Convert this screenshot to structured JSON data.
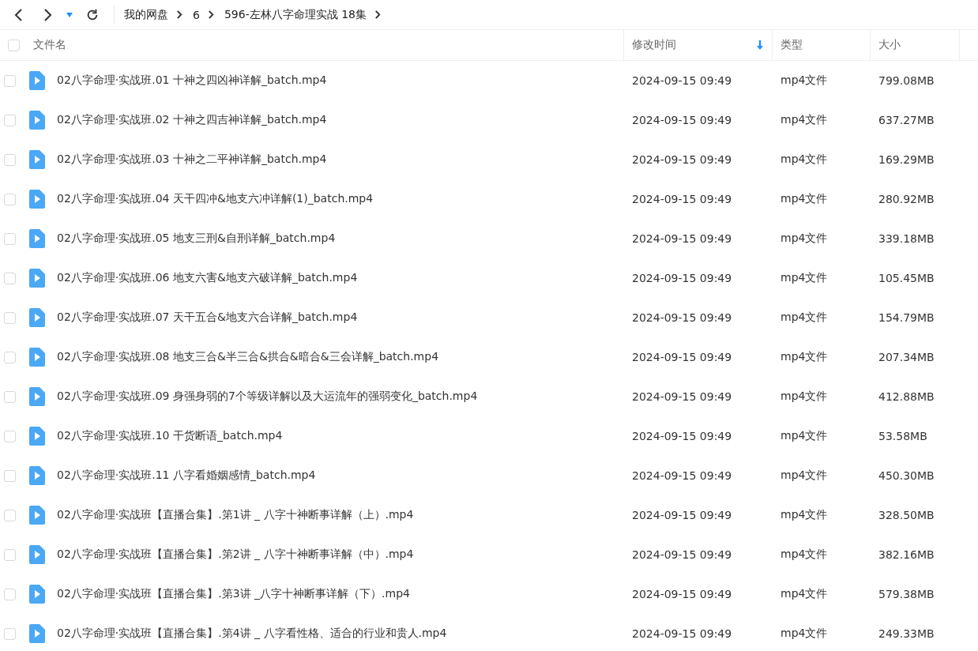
{
  "breadcrumb": [
    "我的网盘",
    "6",
    "596-左林八字命理实战 18集"
  ],
  "table": {
    "select_all": {
      "checked": false
    },
    "columns": [
      {
        "label": "文件名",
        "sorted": false
      },
      {
        "label": "修改时间",
        "sorted": true
      },
      {
        "label": "类型",
        "sorted": false
      },
      {
        "label": "大小",
        "sorted": false
      }
    ],
    "rows": [
      {
        "checked": false,
        "name": "02八字命理·实战班.01 十神之四凶神详解_batch.mp4",
        "modified": "2024-09-15 09:49",
        "type": "mp4文件",
        "size": "799.08MB"
      },
      {
        "checked": false,
        "name": "02八字命理·实战班.02 十神之四吉神详解_batch.mp4",
        "modified": "2024-09-15 09:49",
        "type": "mp4文件",
        "size": "637.27MB"
      },
      {
        "checked": false,
        "name": "02八字命理·实战班.03 十神之二平神详解_batch.mp4",
        "modified": "2024-09-15 09:49",
        "type": "mp4文件",
        "size": "169.29MB"
      },
      {
        "checked": false,
        "name": "02八字命理·实战班.04 天干四冲&地支六冲详解(1)_batch.mp4",
        "modified": "2024-09-15 09:49",
        "type": "mp4文件",
        "size": "280.92MB"
      },
      {
        "checked": false,
        "name": "02八字命理·实战班.05 地支三刑&自刑详解_batch.mp4",
        "modified": "2024-09-15 09:49",
        "type": "mp4文件",
        "size": "339.18MB"
      },
      {
        "checked": false,
        "name": "02八字命理·实战班.06 地支六害&地支六破详解_batch.mp4",
        "modified": "2024-09-15 09:49",
        "type": "mp4文件",
        "size": "105.45MB"
      },
      {
        "checked": false,
        "name": "02八字命理·实战班.07 天干五合&地支六合详解_batch.mp4",
        "modified": "2024-09-15 09:49",
        "type": "mp4文件",
        "size": "154.79MB"
      },
      {
        "checked": false,
        "name": "02八字命理·实战班.08 地支三合&半三合&拱合&暗合&三会详解_batch.mp4",
        "modified": "2024-09-15 09:49",
        "type": "mp4文件",
        "size": "207.34MB"
      },
      {
        "checked": false,
        "name": "02八字命理·实战班.09 身强身弱的7个等级详解以及大运流年的强弱变化_batch.mp4",
        "modified": "2024-09-15 09:49",
        "type": "mp4文件",
        "size": "412.88MB"
      },
      {
        "checked": false,
        "name": "02八字命理·实战班.10 干货断语_batch.mp4",
        "modified": "2024-09-15 09:49",
        "type": "mp4文件",
        "size": "53.58MB"
      },
      {
        "checked": false,
        "name": "02八字命理·实战班.11 八字看婚姻感情_batch.mp4",
        "modified": "2024-09-15 09:49",
        "type": "mp4文件",
        "size": "450.30MB"
      },
      {
        "checked": false,
        "name": "02八字命理·实战班【直播合集】.第1讲 _ 八字十神断事详解（上）.mp4",
        "modified": "2024-09-15 09:49",
        "type": "mp4文件",
        "size": "328.50MB"
      },
      {
        "checked": false,
        "name": "02八字命理·实战班【直播合集】.第2讲 _ 八字十神断事详解（中）.mp4",
        "modified": "2024-09-15 09:49",
        "type": "mp4文件",
        "size": "382.16MB"
      },
      {
        "checked": false,
        "name": "02八字命理·实战班【直播合集】.第3讲 _八字十神断事详解（下）.mp4",
        "modified": "2024-09-15 09:49",
        "type": "mp4文件",
        "size": "579.38MB"
      },
      {
        "checked": false,
        "name": "02八字命理·实战班【直播合集】.第4讲 _ 八字看性格、适合的行业和贵人.mp4",
        "modified": "2024-09-15 09:49",
        "type": "mp4文件",
        "size": "249.33MB"
      }
    ]
  }
}
